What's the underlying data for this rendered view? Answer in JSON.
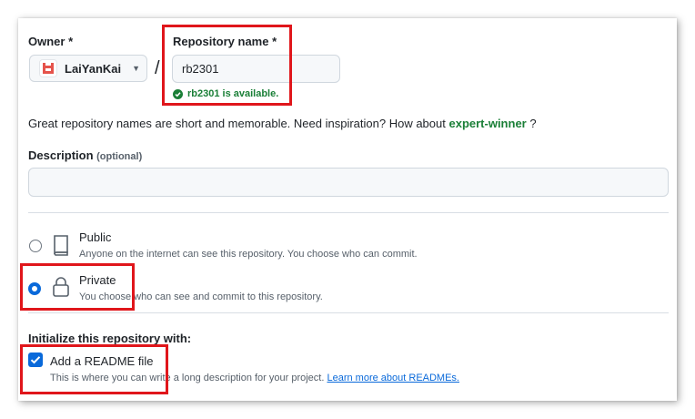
{
  "owner": {
    "label": "Owner *",
    "name": "LaiYanKai"
  },
  "repository": {
    "label": "Repository name *",
    "value": "rb2301",
    "availability": "rb2301 is available."
  },
  "hint": {
    "text": "Great repository names are short and memorable. Need inspiration? How about",
    "suggestion": "expert-winner",
    "suffix": "?"
  },
  "description": {
    "label": "Description",
    "optional": "(optional)",
    "value": ""
  },
  "visibility": {
    "options": [
      {
        "title": "Public",
        "desc": "Anyone on the internet can see this repository. You choose who can commit.",
        "selected": false
      },
      {
        "title": "Private",
        "desc": "You choose who can see and commit to this repository.",
        "selected": true
      }
    ]
  },
  "init": {
    "heading": "Initialize this repository with:",
    "readme_label": "Add a README file",
    "readme_checked": true,
    "readme_desc": "This is where you can write a long description for your project.",
    "readme_link": "Learn more about READMEs."
  },
  "colors": {
    "accent": "#0969da",
    "success": "#1a7f37",
    "highlight": "#e0161b"
  }
}
